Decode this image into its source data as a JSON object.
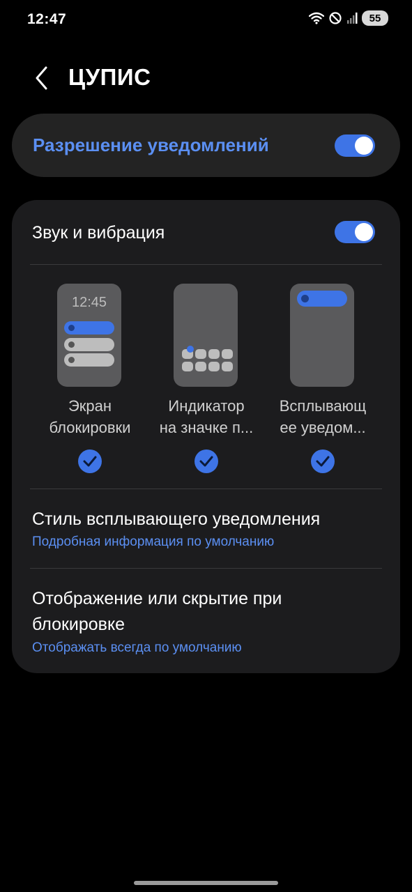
{
  "status_bar": {
    "time": "12:47",
    "battery": "55"
  },
  "header": {
    "title": "ЦУПИС"
  },
  "master_toggle": {
    "label": "Разрешение уведомлений",
    "enabled": true
  },
  "sound": {
    "label": "Звук и вибрация",
    "enabled": true
  },
  "alert_styles": [
    {
      "caption_line1": "Экран",
      "caption_line2": "блокировки",
      "checked": true,
      "preview_time": "12:45"
    },
    {
      "caption_line1": "Индикатор",
      "caption_line2": "на значке п...",
      "checked": true
    },
    {
      "caption_line1": "Всплывающ",
      "caption_line2": "ее уведом...",
      "checked": true
    }
  ],
  "popup_style": {
    "title": "Стиль всплывающего уведомления",
    "value": "Подробная информация по умолчанию"
  },
  "lock_visibility": {
    "title_line1": "Отображение или скрытие при",
    "title_line2": "блокировке",
    "value": "Отображать всегда по умолчанию"
  },
  "colors": {
    "accent": "#3e74e6",
    "accent_text": "#5b8ff2",
    "card": "#1c1c1e",
    "background": "#000000"
  }
}
